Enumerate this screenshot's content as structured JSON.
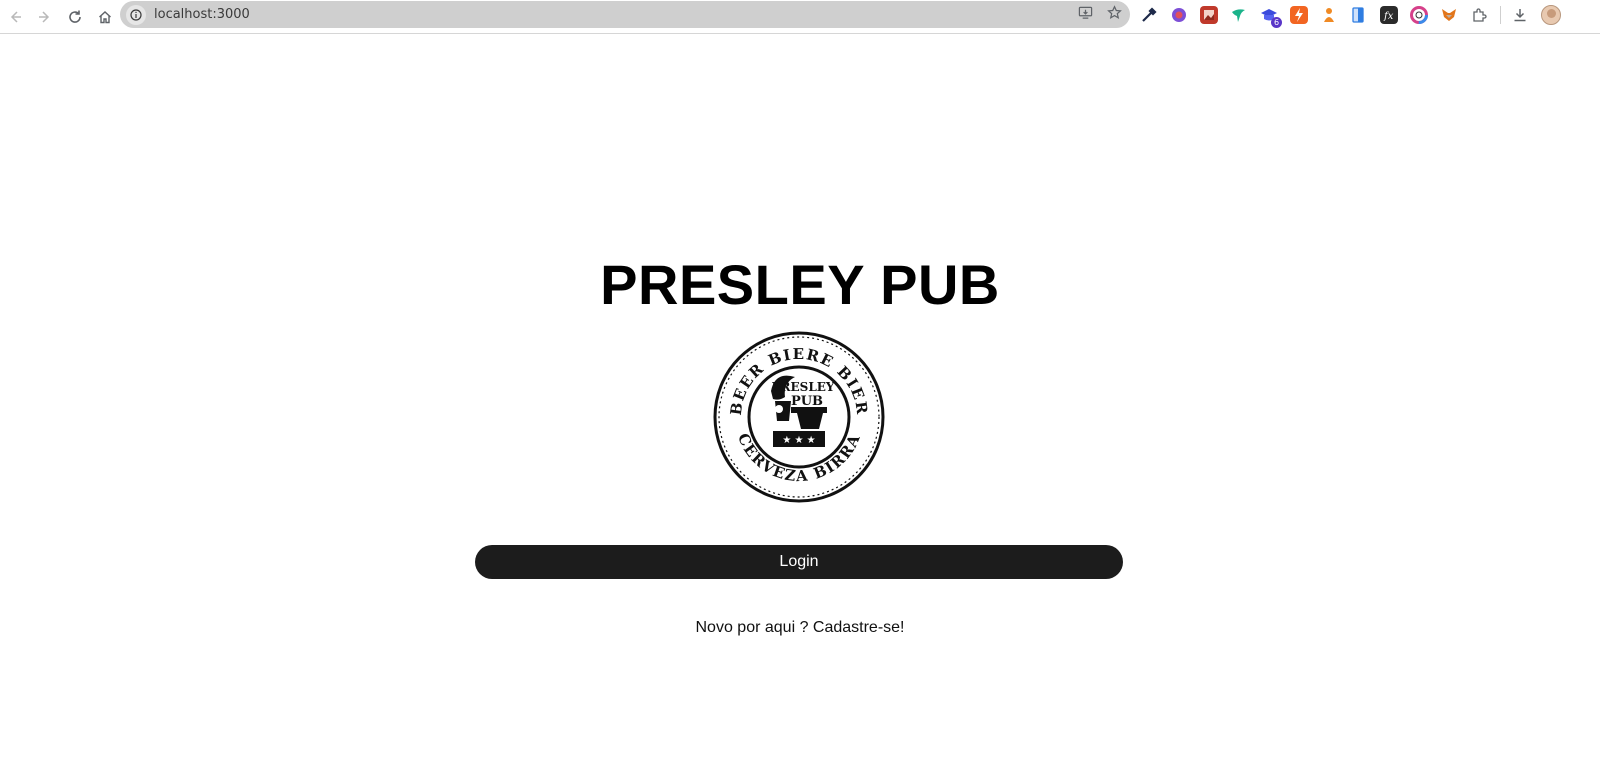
{
  "browser": {
    "url": "localhost:3000",
    "extension_badge": "6",
    "extensions": [
      {
        "name": "eyedropper-extension-icon",
        "color": "#1e2a4a"
      },
      {
        "name": "purple-orb-extension-icon",
        "color": "#7d4fd6"
      },
      {
        "name": "red-image-extension-icon",
        "color": "#c0392b"
      },
      {
        "name": "green-bird-extension-icon",
        "color": "#1bb38a"
      },
      {
        "name": "graduation-cap-extension-icon",
        "color": "#3b4bdc"
      },
      {
        "name": "orange-bolt-extension-icon",
        "color": "#f26522"
      },
      {
        "name": "orange-figure-extension-icon",
        "color": "#f08a24"
      },
      {
        "name": "blue-doc-extension-icon",
        "color": "#2f7de1"
      },
      {
        "name": "dark-fx-extension-icon",
        "color": "#2b2b2b"
      },
      {
        "name": "color-wheel-extension-icon",
        "color": "#d6408a"
      },
      {
        "name": "fox-extension-icon",
        "color": "#e2761b"
      }
    ]
  },
  "page": {
    "title": "PRESLEY PUB",
    "login_label": "Login",
    "signup_text": "Novo por aqui ? Cadastre-se!"
  },
  "logo": {
    "top_text": "BEER BIERE BIER",
    "bottom_text": "CERVEZA BIRRA",
    "center_line1": "PRESLEY",
    "center_line2": "PUB",
    "stars": "★ ★ ★"
  }
}
